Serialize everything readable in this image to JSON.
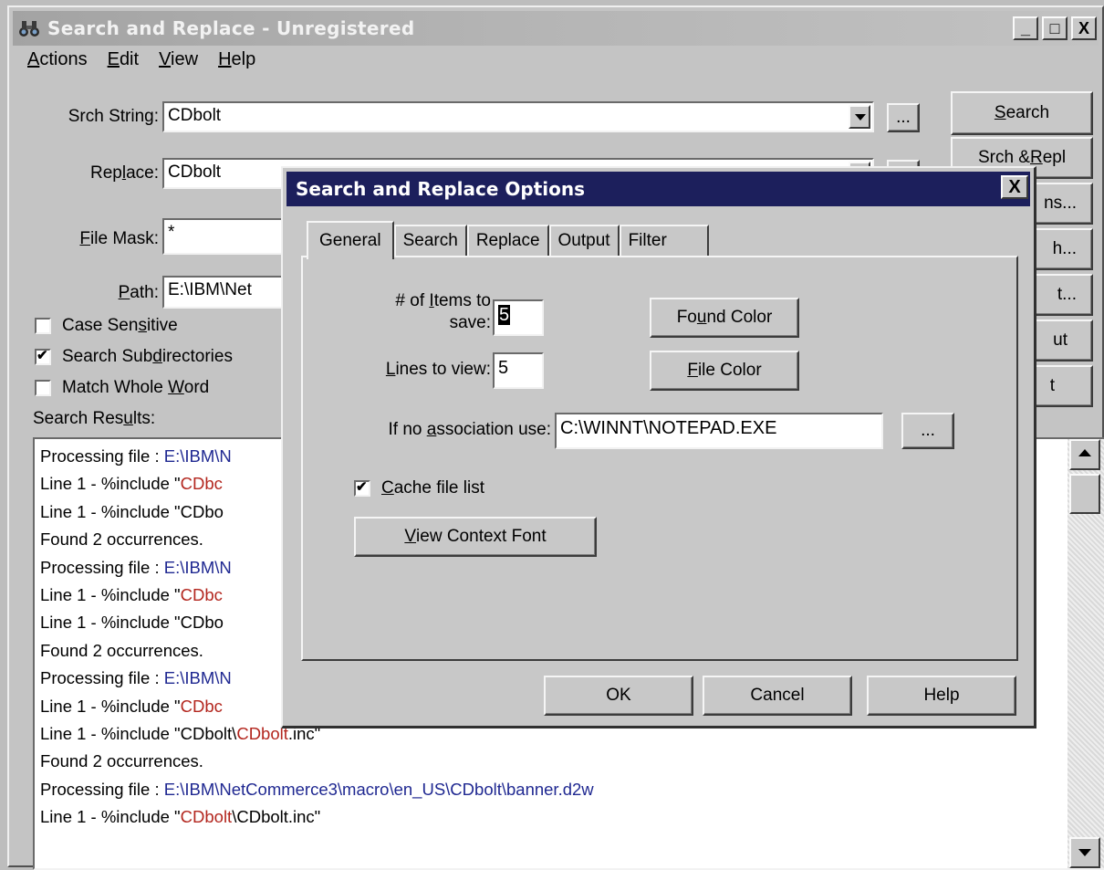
{
  "window": {
    "title": "Search and Replace - Unregistered",
    "buttons": {
      "minimize": "_",
      "maximize": "□",
      "close": "X"
    }
  },
  "menu": [
    {
      "pre": "",
      "accel": "A",
      "post": "ctions"
    },
    {
      "pre": "",
      "accel": "E",
      "post": "dit"
    },
    {
      "pre": "",
      "accel": "V",
      "post": "iew"
    },
    {
      "pre": "",
      "accel": "H",
      "post": "elp"
    }
  ],
  "form": {
    "srch_string": {
      "pre": "Srch Strin",
      "accel": "g",
      "post": ":",
      "value": "CDbolt"
    },
    "replace": {
      "pre": "Rep",
      "accel": "l",
      "post": "ace:",
      "value": "CDbolt"
    },
    "file_mask": {
      "pre": "",
      "accel": "F",
      "post": "ile Mask:",
      "value": "*"
    },
    "path": {
      "pre": "",
      "accel": "P",
      "post": "ath:",
      "value": "E:\\IBM\\Net"
    },
    "browse": "..."
  },
  "checkboxes": [
    {
      "pre": "Case Sen",
      "accel": "s",
      "post": "itive",
      "checked": false
    },
    {
      "pre": "Search Sub",
      "accel": "d",
      "post": "irectories",
      "checked": true
    },
    {
      "pre": "Match Whole ",
      "accel": "W",
      "post": "ord",
      "checked": false
    }
  ],
  "results_label": {
    "pre": "Search Res",
    "accel": "u",
    "post": "lts:"
  },
  "side_buttons": [
    {
      "pre": "",
      "accel": "S",
      "post": "earch"
    },
    {
      "pre": "Srch & ",
      "accel": "R",
      "post": "epl"
    },
    {
      "pre": "",
      "accel": "",
      "post": "ns..."
    },
    {
      "pre": "",
      "accel": "",
      "post": "h..."
    },
    {
      "pre": "",
      "accel": "",
      "post": "t..."
    },
    {
      "pre": "",
      "accel": "",
      "post": "ut"
    },
    {
      "pre": "",
      "accel": "",
      "post": "t"
    }
  ],
  "results": [
    [
      {
        "t": "Processing file : ",
        "c": ""
      },
      {
        "t": "E:\\IBM\\N",
        "c": "blue"
      }
    ],
    [
      {
        "t": "Line   1 - %include \"",
        "c": ""
      },
      {
        "t": "CDbc",
        "c": "red"
      }
    ],
    [
      {
        "t": "Line   1 - %include \"CDbo",
        "c": ""
      }
    ],
    [
      {
        "t": "Found 2 occurrences.",
        "c": ""
      }
    ],
    [
      {
        "t": "Processing file : ",
        "c": ""
      },
      {
        "t": "E:\\IBM\\N",
        "c": "blue"
      }
    ],
    [
      {
        "t": "Line   1 - %include \"",
        "c": ""
      },
      {
        "t": "CDbc",
        "c": "red"
      }
    ],
    [
      {
        "t": "Line   1 - %include \"CDbo",
        "c": ""
      }
    ],
    [
      {
        "t": "Found 2 occurrences.",
        "c": ""
      }
    ],
    [
      {
        "t": "Processing file : ",
        "c": ""
      },
      {
        "t": "E:\\IBM\\N",
        "c": "blue"
      }
    ],
    [
      {
        "t": "Line   1 - %include \"",
        "c": ""
      },
      {
        "t": "CDbc",
        "c": "red"
      }
    ],
    [
      {
        "t": "Line   1 - %include \"CDbolt\\",
        "c": ""
      },
      {
        "t": "CDbolt",
        "c": "red"
      },
      {
        "t": ".inc\"",
        "c": ""
      }
    ],
    [
      {
        "t": "Found 2 occurrences.",
        "c": ""
      }
    ],
    [
      {
        "t": "Processing file : ",
        "c": ""
      },
      {
        "t": "E:\\IBM\\NetCommerce3\\macro\\en_US\\CDbolt\\banner.d2w",
        "c": "blue"
      }
    ],
    [
      {
        "t": "Line   1 - %include \"",
        "c": ""
      },
      {
        "t": "CDbolt",
        "c": "red"
      },
      {
        "t": "\\CDbolt.inc\"",
        "c": ""
      }
    ]
  ],
  "dialog": {
    "title": "Search and Replace Options",
    "close": "X",
    "tabs": [
      "General",
      "Search",
      "Replace",
      "Output",
      "Filter"
    ],
    "items_label_line1": {
      "pre": "# of ",
      "accel": "I",
      "post": "tems to"
    },
    "items_label_line2": "save:",
    "items_value": "5",
    "lines_label": {
      "pre": "",
      "accel": "L",
      "post": "ines to view:"
    },
    "lines_value": "5",
    "found_color": {
      "pre": "Fo",
      "accel": "u",
      "post": "nd Color"
    },
    "file_color": {
      "pre": "",
      "accel": "F",
      "post": "ile Color"
    },
    "assoc_label": {
      "pre": "If no ",
      "accel": "a",
      "post": "ssociation use:"
    },
    "assoc_value": "C:\\WINNT\\NOTEPAD.EXE",
    "assoc_browse": "...",
    "cache_label": {
      "pre": "",
      "accel": "C",
      "post": "ache file list"
    },
    "cache_checked": true,
    "context_font": {
      "pre": "",
      "accel": "V",
      "post": "iew Context Font"
    },
    "ok": "OK",
    "cancel": "Cancel",
    "help": "Help"
  },
  "colors": {
    "dialog_title_bg": "#1c1f5c",
    "path_text": "#1f2891",
    "match_text": "#b3261e"
  }
}
